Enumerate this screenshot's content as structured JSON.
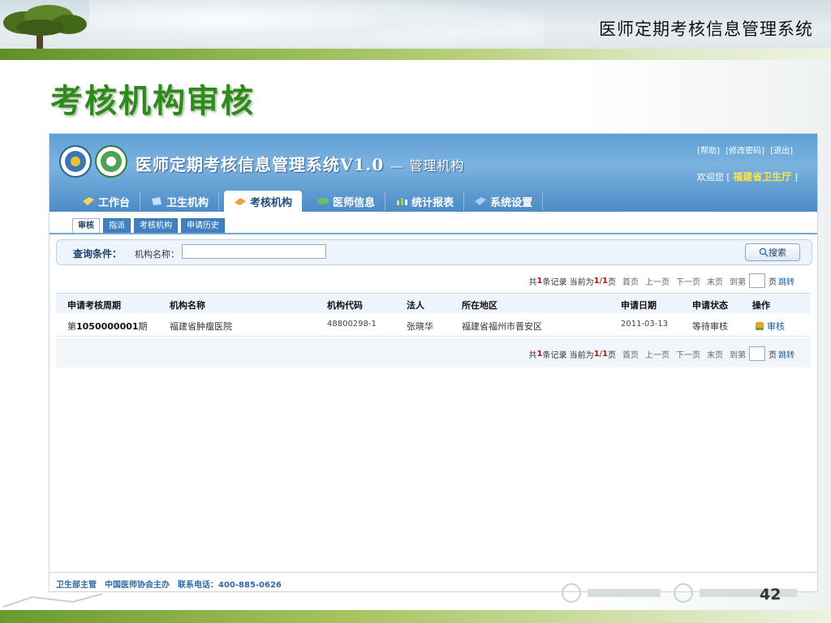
{
  "slide": {
    "header_title": "医师定期考核信息管理系统",
    "title": "考核机构审核",
    "page_number": "42"
  },
  "app": {
    "title": "医师定期考核信息管理系统V1.0",
    "title_suffix": "— 管理机构",
    "top_links": [
      "[帮助]",
      "[修改密码]",
      "[退出]"
    ],
    "welcome_prefix": "欢迎您 [",
    "welcome_org": "福建省卫生厅",
    "welcome_suffix": "]",
    "nav": [
      {
        "label": "工作台",
        "icon": "workbench-icon"
      },
      {
        "label": "卫生机构",
        "icon": "institution-icon"
      },
      {
        "label": "考核机构",
        "icon": "assessment-icon"
      },
      {
        "label": "医师信息",
        "icon": "doctor-icon"
      },
      {
        "label": "统计报表",
        "icon": "report-icon"
      },
      {
        "label": "系统设置",
        "icon": "settings-icon"
      }
    ],
    "subtabs": [
      "审核",
      "指派",
      "考核机构",
      "申请历史"
    ],
    "query": {
      "label": "查询条件：",
      "field_label": "机构名称：",
      "field_value": "",
      "search_label": "搜索"
    },
    "pager": {
      "prefix": "共",
      "count": "1",
      "count_suffix": "条记录 当前为",
      "current": "1",
      "sep": "/",
      "total": "1",
      "page_unit": "页",
      "first": "首页",
      "prev": "上一页",
      "next": "下一页",
      "last": "末页",
      "goto": "到第",
      "page_suffix": "页",
      "jump": "跳转"
    },
    "table": {
      "columns": [
        "申请考核周期",
        "机构名称",
        "机构代码",
        "法人",
        "所在地区",
        "申请日期",
        "申请状态",
        "操作"
      ],
      "rows": [
        {
          "period_prefix": "第",
          "period_num": "1050000001",
          "period_suffix": "期",
          "name": "福建省肿瘤医院",
          "code": "48800298-1",
          "legal": "张晓华",
          "region": "福建省福州市晋安区",
          "date": "2011-03-13",
          "status": "等待审核",
          "action": "审核"
        }
      ]
    },
    "footer": "卫生部主管　中国医师协会主办　联系电话：400-885-0626"
  }
}
